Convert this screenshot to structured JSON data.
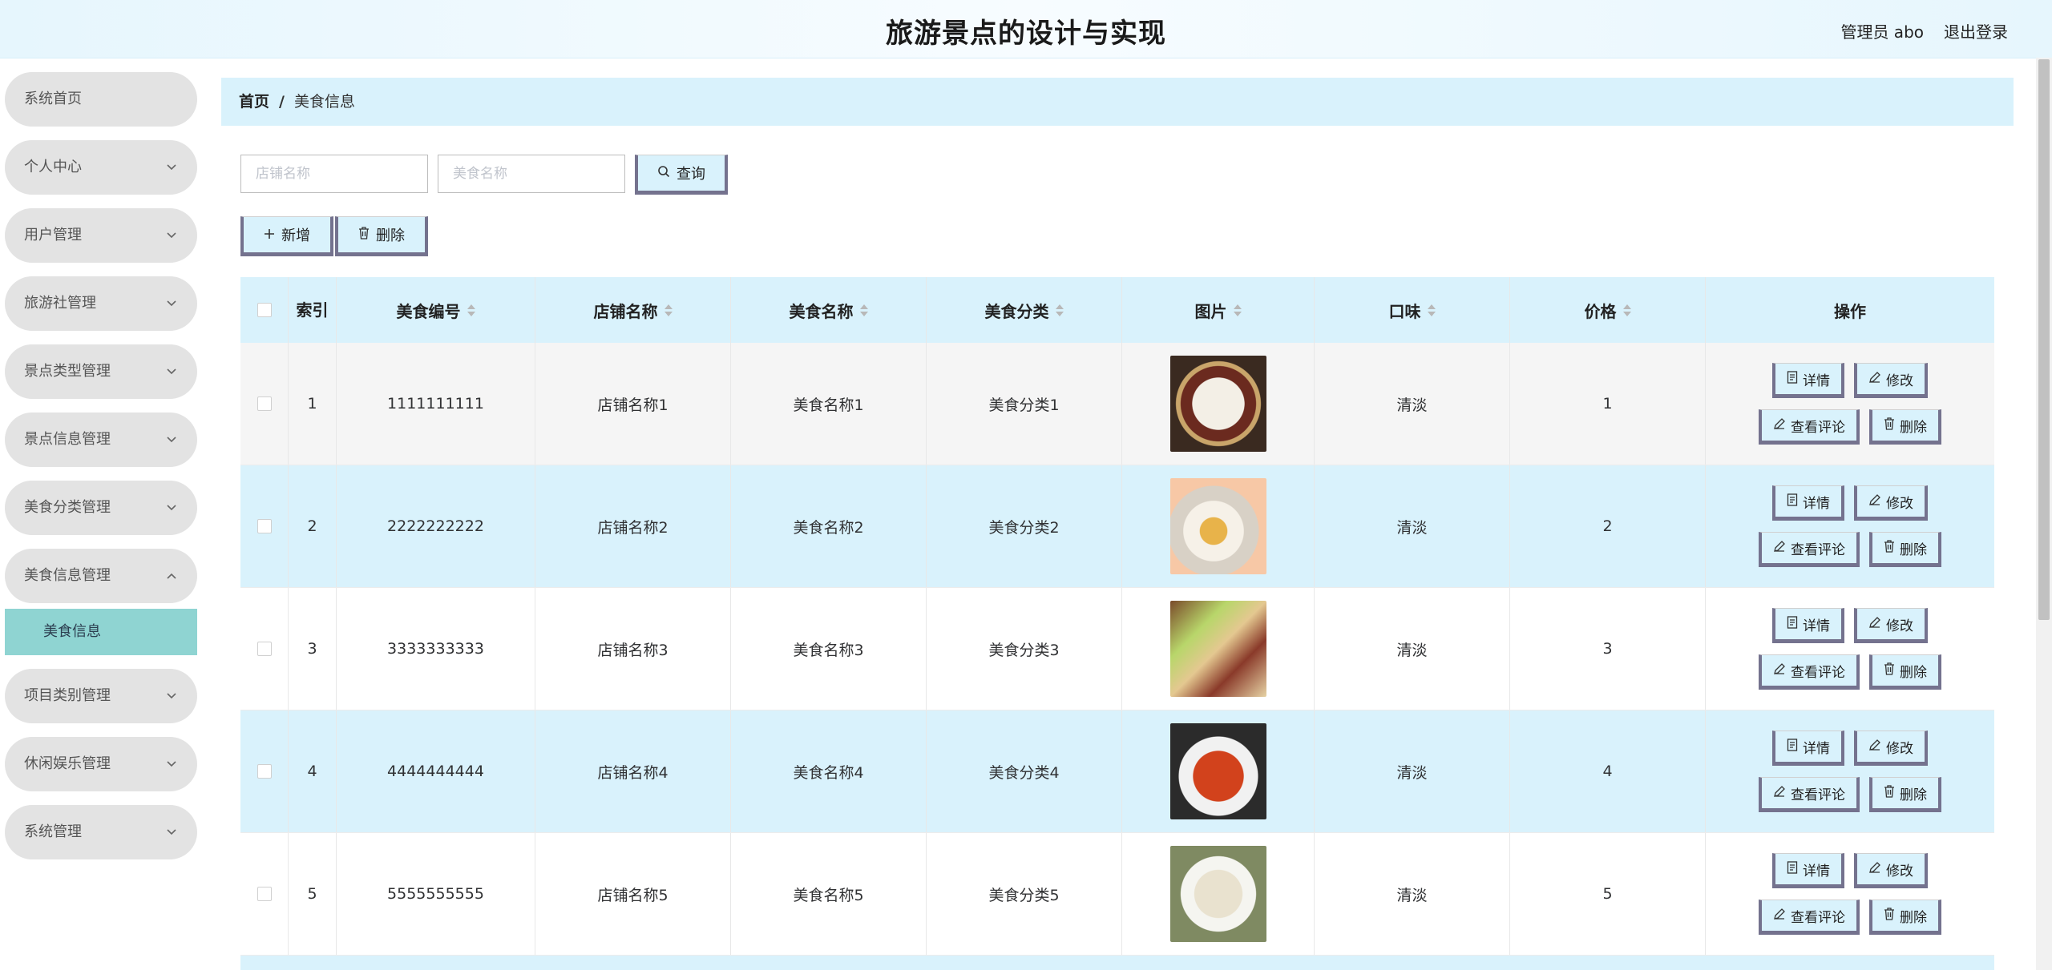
{
  "header": {
    "title": "旅游景点的设计与实现",
    "user": "管理员 abo",
    "logout": "退出登录"
  },
  "sidebar": {
    "items": [
      {
        "label": "系统首页"
      },
      {
        "label": "个人中心"
      },
      {
        "label": "用户管理"
      },
      {
        "label": "旅游社管理"
      },
      {
        "label": "景点类型管理"
      },
      {
        "label": "景点信息管理"
      },
      {
        "label": "美食分类管理"
      },
      {
        "label": "美食信息管理"
      },
      {
        "label": "项目类别管理"
      },
      {
        "label": "休闲娱乐管理"
      },
      {
        "label": "系统管理"
      }
    ],
    "active_sub": "美食信息"
  },
  "breadcrumb": {
    "home": "首页",
    "sep": "/",
    "current": "美食信息"
  },
  "search": {
    "shop_placeholder": "店铺名称",
    "food_placeholder": "美食名称",
    "query_label": "查询"
  },
  "actions": {
    "add_label": "新增",
    "delete_label": "删除"
  },
  "table": {
    "headers": {
      "index": "索引",
      "code": "美食编号",
      "shop": "店铺名称",
      "name": "美食名称",
      "category": "美食分类",
      "image": "图片",
      "taste": "口味",
      "price": "价格",
      "ops": "操作"
    },
    "rows": [
      {
        "index": "1",
        "code": "1111111111",
        "shop": "店铺名称1",
        "name": "美食名称1",
        "category": "美食分类1",
        "taste": "清淡",
        "price": "1"
      },
      {
        "index": "2",
        "code": "2222222222",
        "shop": "店铺名称2",
        "name": "美食名称2",
        "category": "美食分类2",
        "taste": "清淡",
        "price": "2"
      },
      {
        "index": "3",
        "code": "3333333333",
        "shop": "店铺名称3",
        "name": "美食名称3",
        "category": "美食分类3",
        "taste": "清淡",
        "price": "3"
      },
      {
        "index": "4",
        "code": "4444444444",
        "shop": "店铺名称4",
        "name": "美食名称4",
        "category": "美食分类4",
        "taste": "清淡",
        "price": "4"
      },
      {
        "index": "5",
        "code": "5555555555",
        "shop": "店铺名称5",
        "name": "美食名称5",
        "category": "美食分类5",
        "taste": "清淡",
        "price": "5"
      }
    ],
    "op_labels": {
      "detail": "详情",
      "edit": "修改",
      "comments": "查看评论",
      "delete": "删除"
    }
  },
  "colors": {
    "accent": "#d9f2fc",
    "active_menu": "#8fd4d2",
    "button_border": "#74728e"
  }
}
